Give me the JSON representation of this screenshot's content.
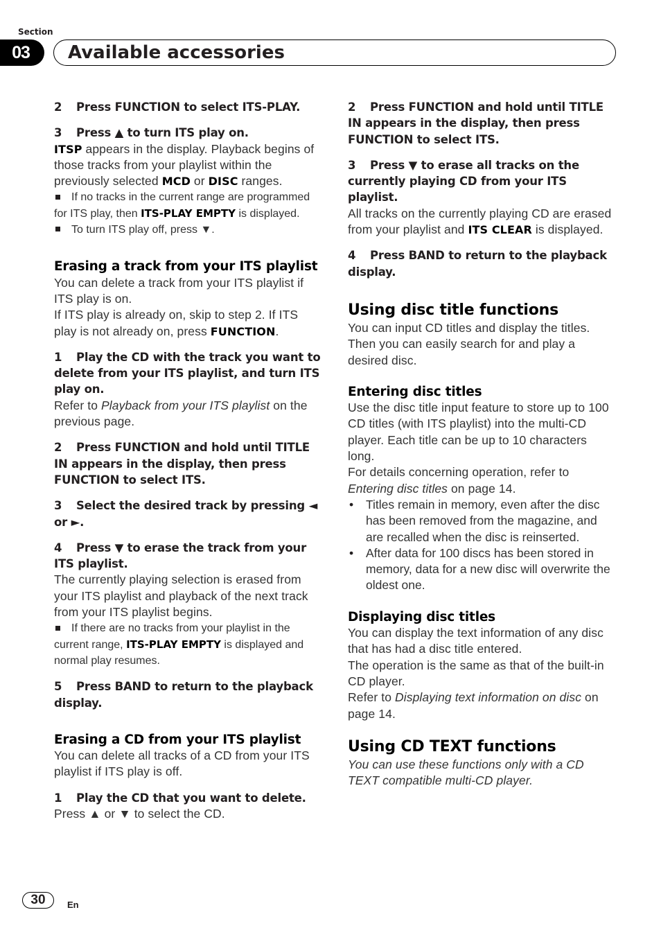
{
  "header": {
    "section_label": "Section",
    "section_number": "03",
    "title": "Available accessories"
  },
  "left_column": {
    "step2_num": "2",
    "step2": "Press FUNCTION to select ITS-PLAY.",
    "step3_num": "3",
    "step3_a": "Press ",
    "step3_icon": "▲",
    "step3_b": " to turn ITS play on.",
    "step3_body": {
      "b1": "ITSP",
      "t1": " appears in the display. Playback begins of those tracks from your playlist within the previously selected ",
      "b2": "MCD",
      "t2": " or ",
      "b3": "DISC",
      "t3": " ranges."
    },
    "note1": {
      "t1": "If no tracks in the current range are programmed for ITS play, then ",
      "b1": "ITS-PLAY EMPTY",
      "t2": " is displayed."
    },
    "note2": {
      "t1": "To turn ITS play off, press ",
      "icon": "▼",
      "t2": "."
    },
    "erase_track": {
      "heading": "Erasing a track from your ITS playlist",
      "intro1": "You can delete a track from your ITS playlist if ITS play is on.",
      "intro2_a": "If ITS play is already on, skip to step 2. If ITS play is not already on, press ",
      "intro2_b": "FUNCTION",
      "intro2_c": ".",
      "s1_num": "1",
      "s1": "Play the CD with the track you want to delete from your ITS playlist, and turn ITS play on.",
      "s1_body_a": "Refer to ",
      "s1_body_i": "Playback from your ITS playlist",
      "s1_body_b": " on the previous page.",
      "s2_num": "2",
      "s2": "Press FUNCTION and hold until TITLE IN appears in the display, then press FUNCTION to select ITS.",
      "s3_num": "3",
      "s3_a": "Select the desired track by pressing ",
      "s3_icon1": "◄",
      "s3_b": " or ",
      "s3_icon2": "►",
      "s3_c": ".",
      "s4_num": "4",
      "s4_a": "Press ",
      "s4_icon": "▼",
      "s4_b": " to erase the track from your ITS playlist.",
      "s4_body": "The currently playing selection is erased from your ITS playlist and playback of the next track from your ITS playlist begins.",
      "s4_note": {
        "t1": "If there are no tracks from your playlist in the current range, ",
        "b1": "ITS-PLAY EMPTY",
        "t2": " is displayed and normal play resumes."
      },
      "s5_num": "5",
      "s5": "Press BAND to return to the playback display."
    },
    "erase_cd": {
      "heading": "Erasing a CD from your ITS playlist",
      "intro": "You can delete all tracks of a CD from your ITS playlist if ITS play is off.",
      "s1_num": "1",
      "s1": "Play the CD that you want to delete.",
      "s1_body_a": "Press ",
      "s1_icon1": "▲",
      "s1_body_b": " or ",
      "s1_icon2": "▼",
      "s1_body_c": " to select the CD."
    }
  },
  "right_column": {
    "s2_num": "2",
    "s2": "Press FUNCTION and hold until TITLE IN appears in the display, then press FUNCTION to select ITS.",
    "s3_num": "3",
    "s3_a": "Press ",
    "s3_icon": "▼",
    "s3_b": " to erase all tracks on the currently playing CD from your ITS playlist.",
    "s3_body": {
      "t1": "All tracks on the currently playing CD are erased from your playlist and ",
      "b1": "ITS CLEAR",
      "t2": " is displayed."
    },
    "s4_num": "4",
    "s4": "Press BAND to return to the playback display.",
    "disc_title": {
      "heading": "Using disc title functions",
      "intro": "You can input CD titles and display the titles. Then you can easily search for and play a desired disc."
    },
    "entering": {
      "heading": "Entering disc titles",
      "body1": "Use the disc title input feature to store up to 100 CD titles  (with ITS playlist) into the multi-CD player. Each title can be up to 10 characters long.",
      "body2_a": "For details concerning operation, refer to ",
      "body2_i": "Entering disc titles",
      "body2_b": " on page 14.",
      "bullets": [
        "Titles remain in memory, even after the disc has been removed from the magazine, and are recalled when the disc is reinserted.",
        "After data for 100 discs has been stored in memory, data for a new disc will overwrite the oldest one."
      ]
    },
    "displaying": {
      "heading": "Displaying disc titles",
      "body1": "You can display the text information of any disc that has had a disc title entered.",
      "body2": "The operation is the same as that of the built-in CD player.",
      "body3_a": "Refer to ",
      "body3_i": "Displaying text information on disc",
      "body3_b": " on page 14."
    },
    "cd_text": {
      "heading": "Using CD TEXT functions",
      "intro": "You can use these functions only with a CD TEXT compatible multi-CD player."
    }
  },
  "footer": {
    "page_number": "30",
    "language": "En"
  }
}
